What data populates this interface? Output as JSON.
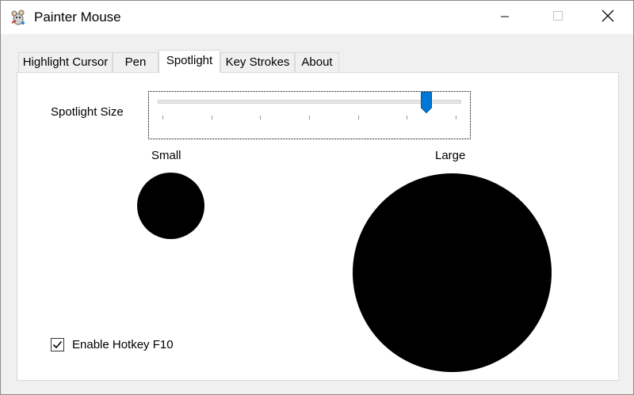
{
  "window": {
    "title": "Painter Mouse",
    "icon": "mouse-painter-icon",
    "controls": {
      "minimize": "minimize-icon",
      "maximize": "maximize-icon",
      "close": "close-icon"
    }
  },
  "tabs": [
    {
      "label": "Highlight Cursor",
      "active": false
    },
    {
      "label": "Pen",
      "active": false
    },
    {
      "label": "Spotlight",
      "active": true
    },
    {
      "label": "Key Strokes",
      "active": false
    },
    {
      "label": "About",
      "active": false
    }
  ],
  "spotlight": {
    "size_label": "Spotlight Size",
    "slider": {
      "min": 0,
      "max": 6,
      "value": 5.4,
      "ticks": 7,
      "accent_color": "#0078d7"
    },
    "small_label": "Small",
    "large_label": "Large"
  },
  "hotkey": {
    "label": "Enable Hotkey F10",
    "checked": true
  }
}
